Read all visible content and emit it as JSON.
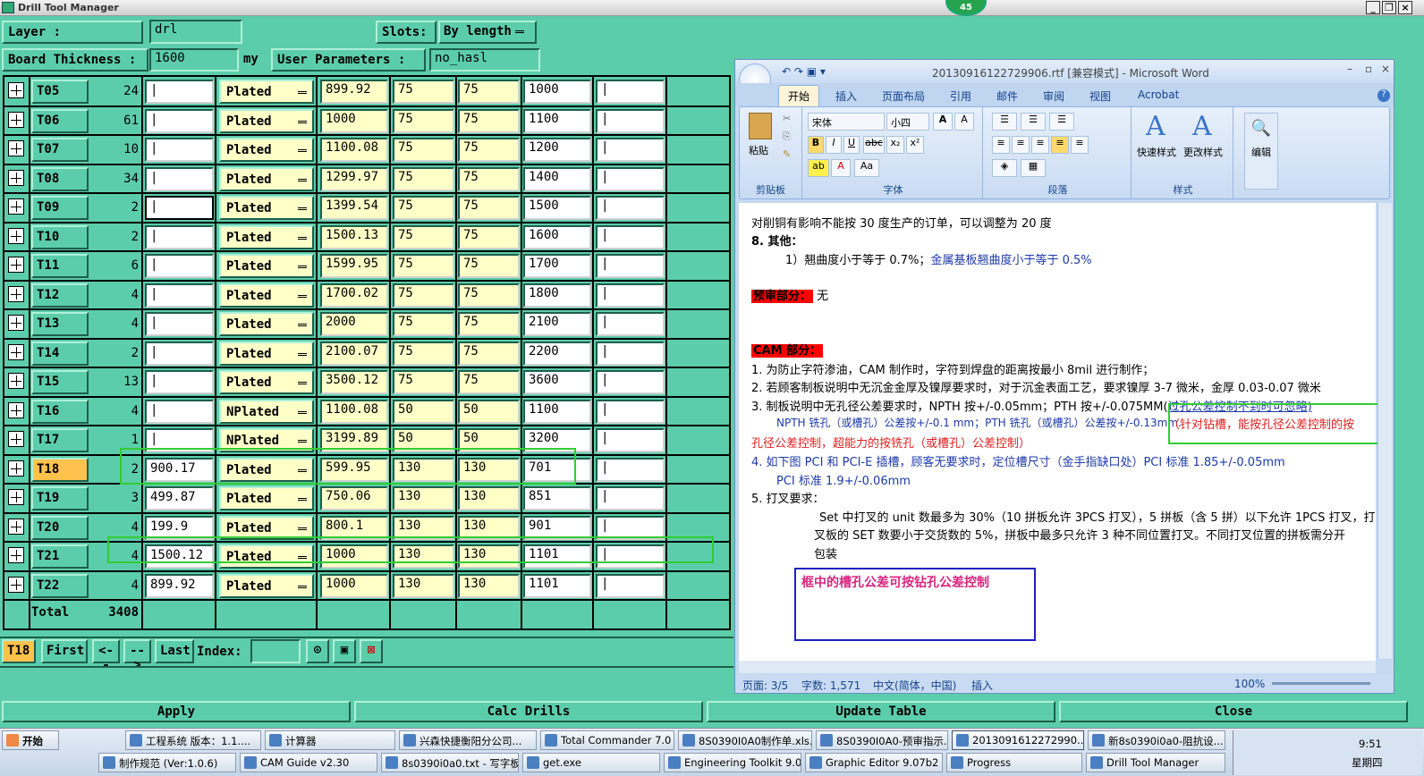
{
  "window_title": "Drill Tool Manager",
  "badge": "45",
  "header": {
    "layer_label": "Layer :",
    "layer_value": "drl",
    "slots_label": "Slots:",
    "slots_value": "By length",
    "thickness_label": "Board Thickness :",
    "thickness_value": "1600",
    "thickness_unit": "my",
    "user_params_label": "User Parameters :",
    "user_params_value": "no_hasl"
  },
  "rows": [
    {
      "tool": "T05",
      "count": "24",
      "size": "",
      "type": "Plated",
      "v1": "899.92",
      "v2": "75",
      "v3": "75",
      "v4": "1000",
      "v5": ""
    },
    {
      "tool": "T06",
      "count": "61",
      "size": "",
      "type": "Plated",
      "v1": "1000",
      "v2": "75",
      "v3": "75",
      "v4": "1100",
      "v5": ""
    },
    {
      "tool": "T07",
      "count": "10",
      "size": "",
      "type": "Plated",
      "v1": "1100.08",
      "v2": "75",
      "v3": "75",
      "v4": "1200",
      "v5": ""
    },
    {
      "tool": "T08",
      "count": "34",
      "size": "",
      "type": "Plated",
      "v1": "1299.97",
      "v2": "75",
      "v3": "75",
      "v4": "1400",
      "v5": ""
    },
    {
      "tool": "T09",
      "count": "2",
      "size": "",
      "type": "Plated",
      "v1": "1399.54",
      "v2": "75",
      "v3": "75",
      "v4": "1500",
      "v5": ""
    },
    {
      "tool": "T10",
      "count": "2",
      "size": "",
      "type": "Plated",
      "v1": "1500.13",
      "v2": "75",
      "v3": "75",
      "v4": "1600",
      "v5": ""
    },
    {
      "tool": "T11",
      "count": "6",
      "size": "",
      "type": "Plated",
      "v1": "1599.95",
      "v2": "75",
      "v3": "75",
      "v4": "1700",
      "v5": ""
    },
    {
      "tool": "T12",
      "count": "4",
      "size": "",
      "type": "Plated",
      "v1": "1700.02",
      "v2": "75",
      "v3": "75",
      "v4": "1800",
      "v5": ""
    },
    {
      "tool": "T13",
      "count": "4",
      "size": "",
      "type": "Plated",
      "v1": "2000",
      "v2": "75",
      "v3": "75",
      "v4": "2100",
      "v5": ""
    },
    {
      "tool": "T14",
      "count": "2",
      "size": "",
      "type": "Plated",
      "v1": "2100.07",
      "v2": "75",
      "v3": "75",
      "v4": "2200",
      "v5": ""
    },
    {
      "tool": "T15",
      "count": "13",
      "size": "",
      "type": "Plated",
      "v1": "3500.12",
      "v2": "75",
      "v3": "75",
      "v4": "3600",
      "v5": ""
    },
    {
      "tool": "T16",
      "count": "4",
      "size": "",
      "type": "NPlated",
      "v1": "1100.08",
      "v2": "50",
      "v3": "50",
      "v4": "1100",
      "v5": ""
    },
    {
      "tool": "T17",
      "count": "1",
      "size": "",
      "type": "NPlated",
      "v1": "3199.89",
      "v2": "50",
      "v3": "50",
      "v4": "3200",
      "v5": ""
    },
    {
      "tool": "T18",
      "count": "2",
      "size": "900.17",
      "type": "Plated",
      "v1": "599.95",
      "v2": "130",
      "v3": "130",
      "v4": "701",
      "v5": ""
    },
    {
      "tool": "T19",
      "count": "3",
      "size": "499.87",
      "type": "Plated",
      "v1": "750.06",
      "v2": "130",
      "v3": "130",
      "v4": "851",
      "v5": ""
    },
    {
      "tool": "T20",
      "count": "4",
      "size": "199.9",
      "type": "Plated",
      "v1": "800.1",
      "v2": "130",
      "v3": "130",
      "v4": "901",
      "v5": ""
    },
    {
      "tool": "T21",
      "count": "4",
      "size": "1500.12",
      "type": "Plated",
      "v1": "1000",
      "v2": "130",
      "v3": "130",
      "v4": "1101",
      "v5": ""
    },
    {
      "tool": "T22",
      "count": "4",
      "size": "899.92",
      "type": "Plated",
      "v1": "1000",
      "v2": "130",
      "v3": "130",
      "v4": "1101",
      "v5": ""
    }
  ],
  "total_label": "Total",
  "total_value": "3408",
  "nav": {
    "current_tool": "T18",
    "first": "First",
    "prev": "<--",
    "next": "-->",
    "last": "Last",
    "index_label": "Index:"
  },
  "buttons": {
    "apply": "Apply",
    "calc": "Calc Drills",
    "update": "Update Table",
    "close": "Close"
  },
  "word": {
    "title": "20130916122729906.rtf [兼容模式] - Microsoft Word",
    "tabs": [
      "开始",
      "插入",
      "页面布局",
      "引用",
      "邮件",
      "审阅",
      "视图",
      "Acrobat"
    ],
    "paste": "粘贴",
    "groups": [
      "剪贴板",
      "字体",
      "段落",
      "样式"
    ],
    "font_name": "宋体",
    "font_size": "小四",
    "quick_style": "快速样式",
    "change_style": "更改样式",
    "edit": "编辑",
    "doc_lines": [
      "对削铜有影响不能按 30 度生产的订单，可以调整为 20 度",
      "8.  其他：",
      "1）翘曲度小于等于 0.7%；",
      "金属基板翘曲度小于等于 0.5%",
      "预审部分：",
      "无",
      "CAM 部分：",
      "1.   为防止字符渗油，CAM 制作时，字符到焊盘的距离按最小 8mil 进行制作；",
      "2.   若顾客制板说明中无沉金金厚及镍厚要求时，对于沉金表面工艺，要求镍厚 3-7 微米，金厚 0.03-0.07 微米",
      "3.   制板说明中无孔径公差要求时，NPTH 按+/-0.05mm；PTH 按+/-0.075MM(",
      "过孔公差控制不到时可忽略)",
      "NPTH 铣孔（或槽孔）公差按+/-0.1 mm；PTH 铣孔（或槽孔）公差按+/-0.13mm.",
      "（针对钻槽，能按孔径公差控制的按",
      "孔径公差控制，超能力的按铣孔（或槽孔）公差控制）",
      "4.   如下图 PCI 和 PCI-E 插槽，顾客无要求时，定位槽尺寸（金手指缺口处）PCI 标准 1.85+/-0.05mm",
      "PCI 标准 1.9+/-0.06mm",
      "5. 打叉要求：",
      "Set 中打叉的 unit 数最多为 30%（10 拼板允许 3PCS 打叉），5 拼板（含 5 拼）以下允许 1PCS 打叉，打",
      "叉板的 SET 数要小于交货数的 5%，拼板中最多只允许 3 种不同位置打叉。不同打叉位置的拼板需分开",
      "包装",
      "框中的槽孔公差可按钻孔公差控制"
    ],
    "status": {
      "page": "页面: 3/5",
      "words": "字数: 1,571",
      "lang": "中文(简体，中国)",
      "mode": "插入",
      "zoom": "100%"
    }
  },
  "taskbar": {
    "start": "开始",
    "row1": [
      "工程系统  版本：1.1....",
      "计算器",
      "兴森快捷衡阳分公司...",
      "Total Commander 7.0 p...",
      "8S0390I0A0制作单.xls...",
      "8S0390I0A0-预审指示...",
      "2013091612272990...",
      "新8s0390i0a0-阻抗设..."
    ],
    "row2": [
      "制作规范 (Ver:1.0.6)",
      "CAM  Guide v2.30",
      "8s0390i0a0.txt - 写字板",
      "get.exe",
      "Engineering Toolkit 9.07...",
      "Graphic Editor 9.07b2 (0...",
      "Progress",
      "Drill Tool Manager"
    ],
    "time": "9:51",
    "day": "星期四"
  },
  "colors": {
    "background": "#5ccdaa",
    "selected_tool": "#ffc24c",
    "yellow_field": "#ffffc8",
    "highlight_green": "#33cc33",
    "note_box": "#2020c0"
  }
}
